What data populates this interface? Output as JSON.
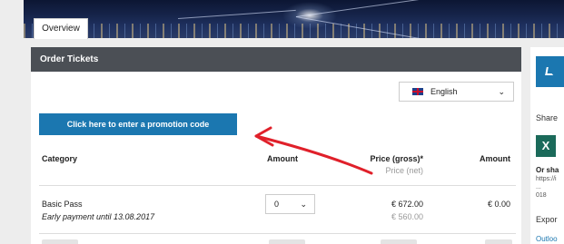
{
  "tabs": {
    "overview": "Overview"
  },
  "panel": {
    "title": "Order Tickets",
    "language": {
      "selected": "English",
      "chevron": "⌄"
    },
    "promo_button": "Click here to enter a promotion code",
    "table": {
      "headers": {
        "category": "Category",
        "amount": "Amount",
        "price": "Price (gross)*",
        "price_net": "Price (net)",
        "total": "Amount"
      },
      "rows": [
        {
          "category": "Basic Pass",
          "note": "Early payment until 13.08.2017",
          "quantity": "0",
          "price_gross": "€ 672.00",
          "price_net": "€ 560.00",
          "total": "€ 0.00"
        }
      ]
    }
  },
  "sidebar": {
    "share_label": "Share",
    "xing_glyph": "X",
    "or_share": "Or sha",
    "link_fragment": "https://i\n...\n018",
    "export_label": "Expor",
    "outlook_label": "Outloo"
  },
  "colors": {
    "accent": "#1b77b0",
    "header_bar": "#4b4f55",
    "annotation_arrow": "#e0202a"
  }
}
